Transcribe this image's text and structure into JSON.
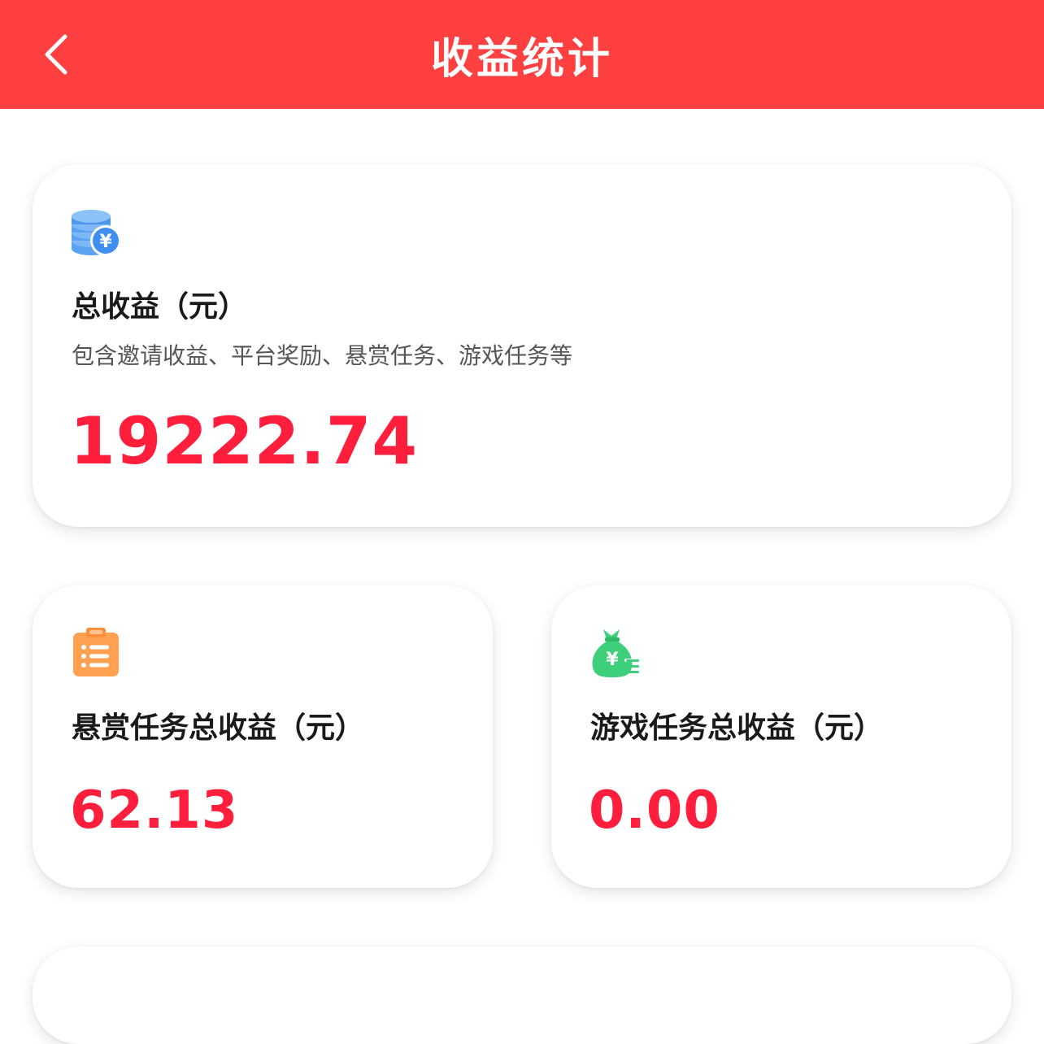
{
  "header": {
    "title": "收益统计",
    "back_icon": "chevron-left-icon",
    "background_color": "#ff4040"
  },
  "total_card": {
    "icon": "coin-stack-yuan-icon",
    "label": "总收益（元）",
    "description": "包含邀请收益、平台奖励、悬赏任务、游戏任务等",
    "value": "19222.74"
  },
  "bounty_card": {
    "icon": "clipboard-list-icon",
    "label": "悬赏任务总收益（元）",
    "value": "62.13"
  },
  "game_card": {
    "icon": "money-bag-yuan-icon",
    "label": "游戏任务总收益（元）",
    "value": "0.00"
  },
  "colors": {
    "value_red": "#ff1f3d",
    "coin_blue": "#3f8ef0",
    "clipboard_orange": "#ffa150",
    "bag_green": "#3ecf7a"
  }
}
